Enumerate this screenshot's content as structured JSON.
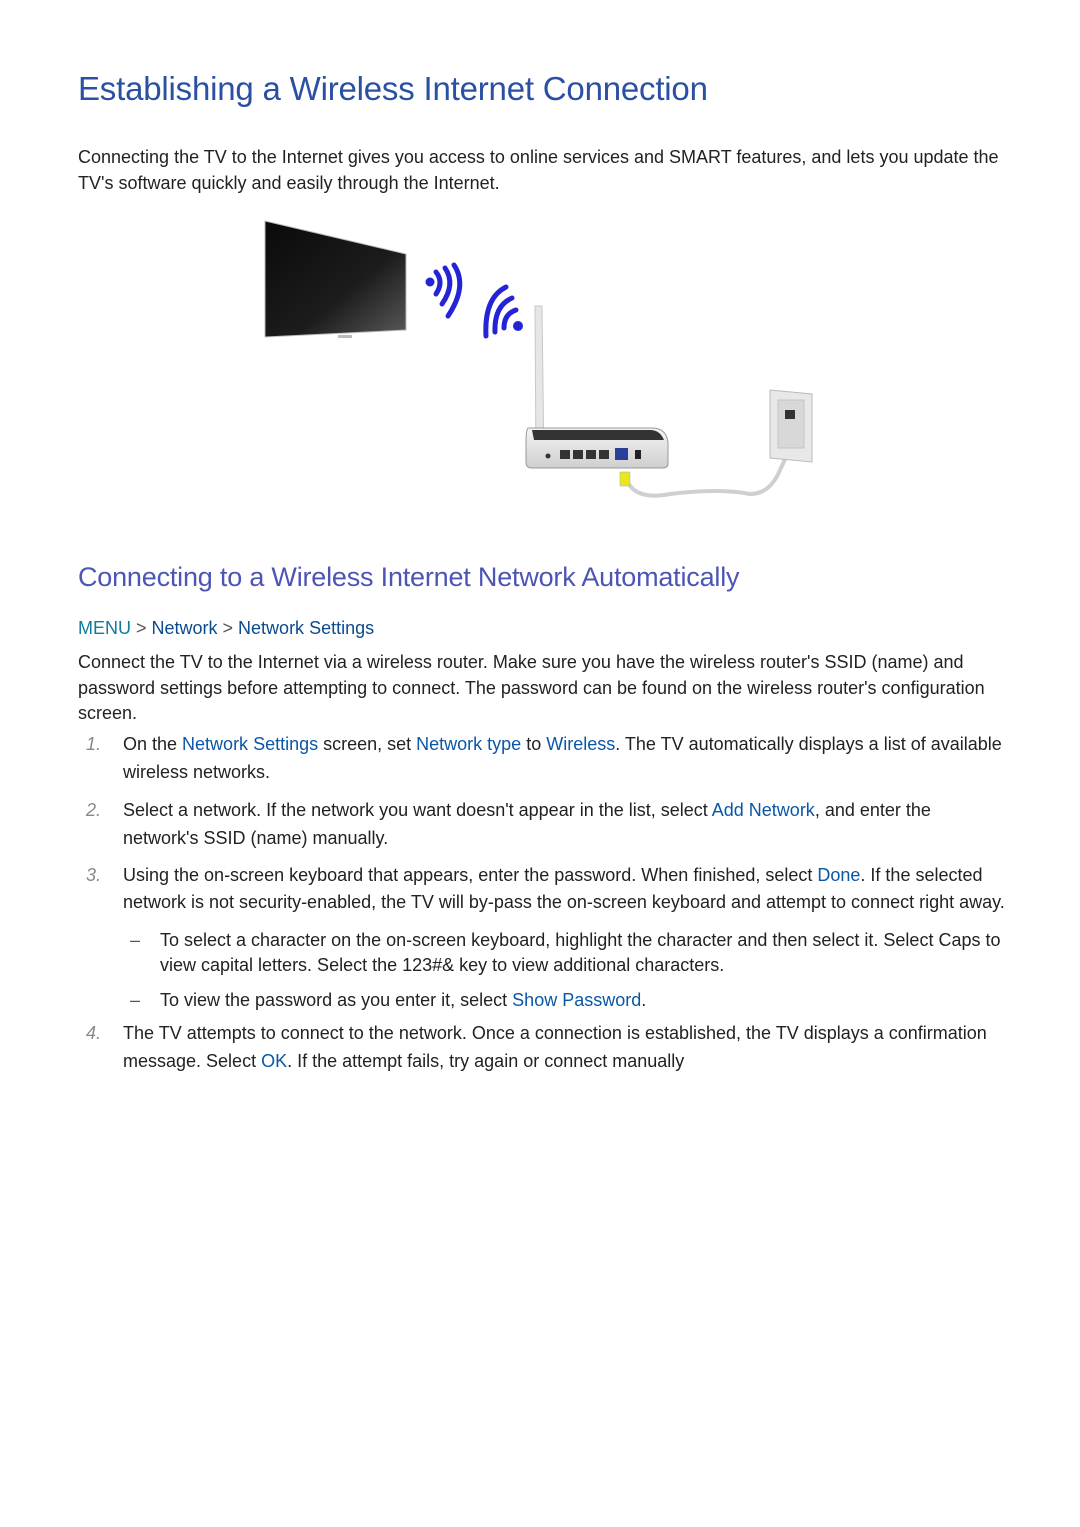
{
  "title": "Establishing a Wireless Internet Connection",
  "intro": "Connecting the TV to the Internet gives you access to online services and SMART features, and lets you update the TV's software quickly and easily through the Internet.",
  "figure": {
    "description": "TV connected wirelessly to a router, router wired to a wall network jack",
    "signal_color": "#2424d6",
    "cable_color": "#e8e81e"
  },
  "section": {
    "title": "Connecting to a Wireless Internet Network Automatically",
    "breadcrumb": {
      "menu": "MENU",
      "sep": ">",
      "item1": "Network",
      "item2": "Network Settings"
    },
    "intro": "Connect the TV to the Internet via a wireless router. Make sure you have the wireless router's SSID (name) and password settings before attempting to connect. The password can be found on the wireless router's configuration screen.",
    "steps": [
      {
        "num": "1.",
        "t1": "On the ",
        "l1": "Network Settings",
        "t2": " screen, set ",
        "l2": "Network type",
        "t3": " to ",
        "l3": "Wireless",
        "t4": ". The TV automatically displays a list of available wireless networks."
      },
      {
        "num": "2.",
        "t1": "Select a network. If the network you want doesn't appear in the list, select ",
        "l1": "Add Network",
        "t2": ", and enter the network's SSID (name) manually."
      },
      {
        "num": "3.",
        "t1": "Using the on-screen keyboard that appears, enter the password. When finished, select ",
        "l1": "Done",
        "t2": ". If the selected network is not security-enabled, the TV will by-pass the on-screen keyboard and attempt to connect right away."
      },
      {
        "num": "4.",
        "t1": "The TV attempts to connect to the network. Once a connection is established, the TV displays a confirmation message. Select ",
        "l1": "OK",
        "t2": ". If the attempt fails, try again or connect manually"
      }
    ],
    "notes": [
      {
        "dash": "–",
        "text": "To select a character on the on-screen keyboard, highlight the character and then select it. Select Caps to view capital letters. Select the 123#& key to view additional characters."
      },
      {
        "dash": "–",
        "t1": "To view the password as you enter it, select ",
        "l1": "Show Password",
        "t2": "."
      }
    ]
  }
}
